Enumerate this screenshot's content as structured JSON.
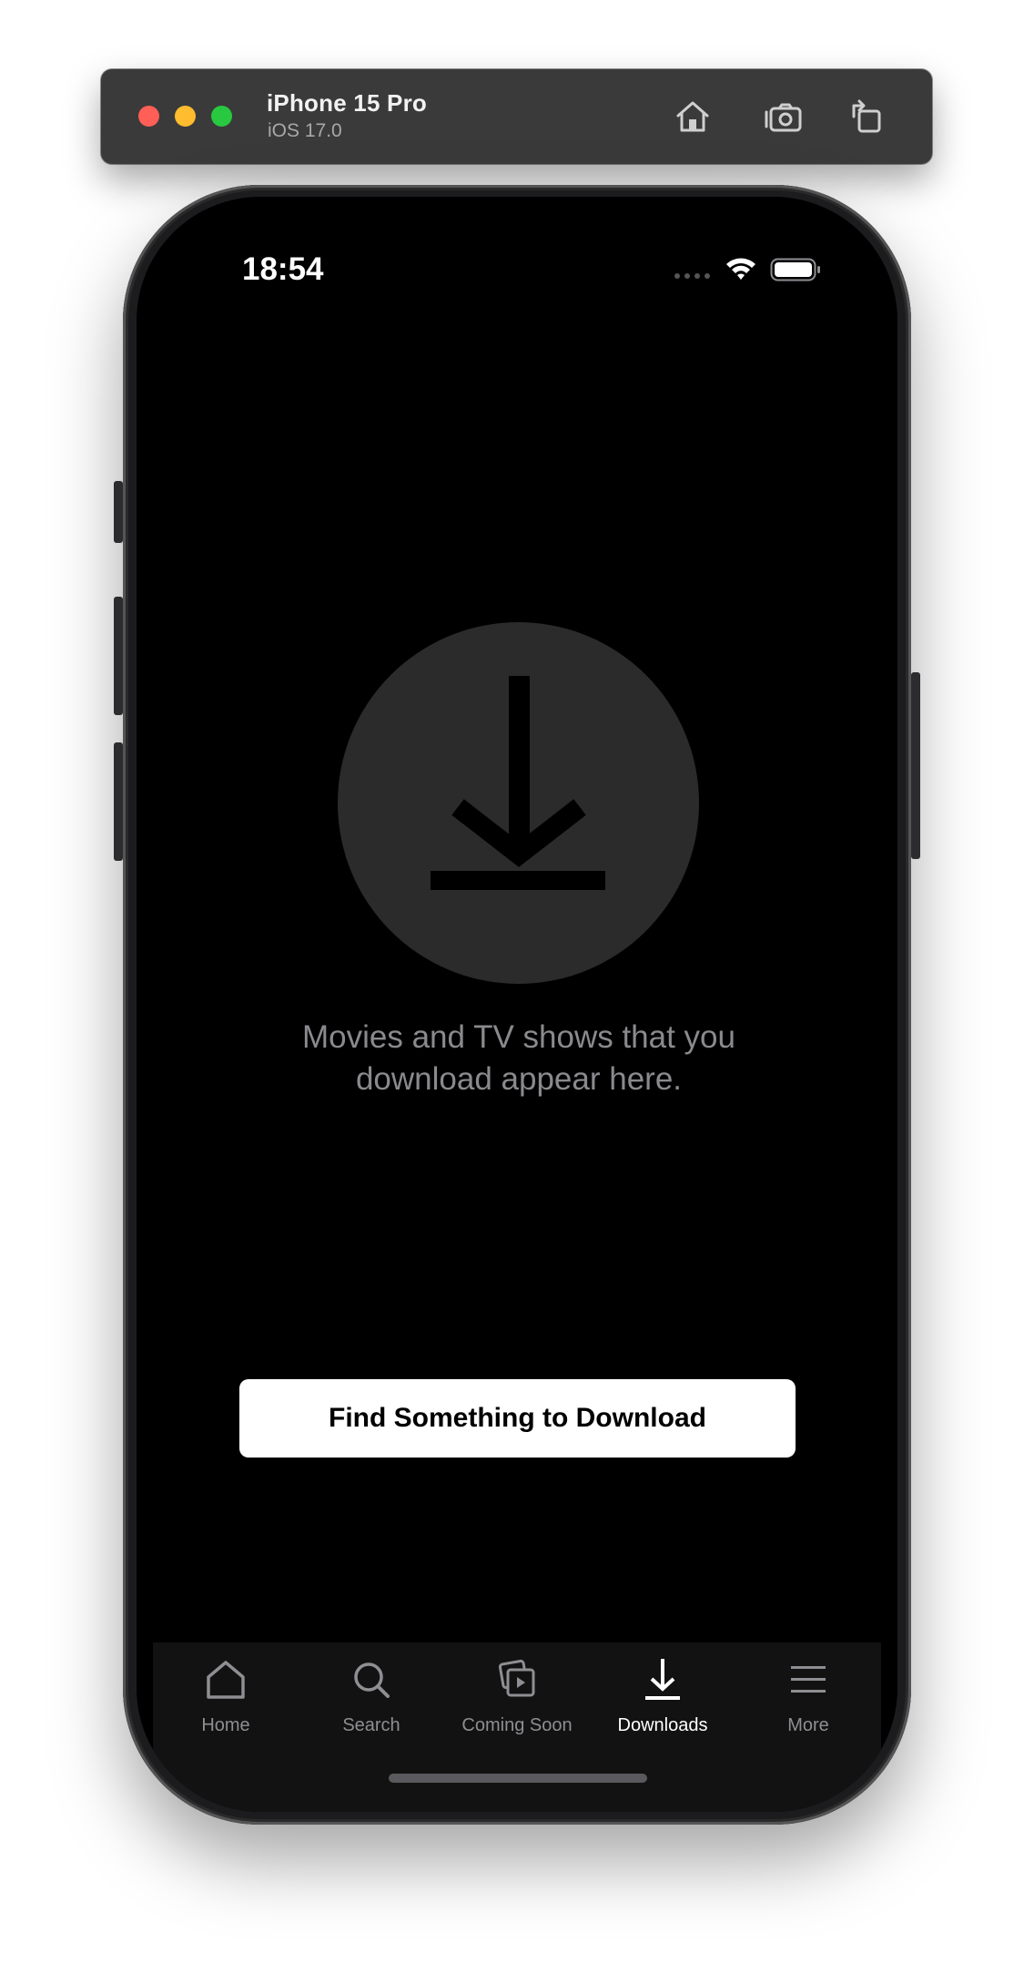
{
  "simulator": {
    "device_name": "iPhone 15 Pro",
    "os_version": "iOS 17.0",
    "toolbar_icons": [
      "home-icon",
      "screenshot-icon",
      "rotate-icon"
    ]
  },
  "status_bar": {
    "time": "18:54",
    "icons": [
      "signal-icon",
      "wifi-icon",
      "battery-icon"
    ]
  },
  "empty_state": {
    "icon": "download-icon",
    "message": "Movies and TV shows that you download appear here."
  },
  "cta": {
    "label": "Find Something to Download"
  },
  "tabbar": {
    "tabs": [
      {
        "label": "Home",
        "icon": "home-icon",
        "active": false
      },
      {
        "label": "Search",
        "icon": "search-icon",
        "active": false
      },
      {
        "label": "Coming Soon",
        "icon": "coming-soon-icon",
        "active": false
      },
      {
        "label": "Downloads",
        "icon": "download-icon",
        "active": true
      },
      {
        "label": "More",
        "icon": "menu-icon",
        "active": false
      }
    ]
  },
  "colors": {
    "screen_background": "#000000",
    "empty_circle": "#2b2b2b",
    "message_text": "#8a8a8e",
    "button_background": "#ffffff",
    "tab_inactive": "#8e8e93",
    "tab_active": "#ffffff"
  }
}
